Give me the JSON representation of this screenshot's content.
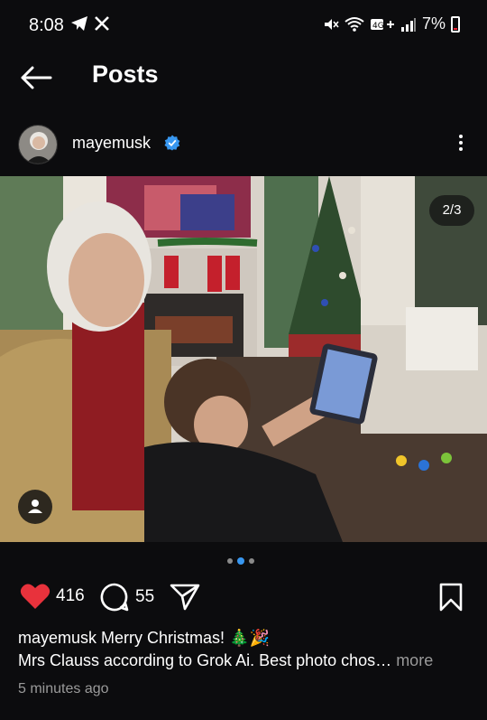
{
  "status_bar": {
    "time": "8:08",
    "left_icons": [
      "telegram-icon",
      "x-icon"
    ],
    "right_icons": [
      "mute-icon",
      "wifi-icon",
      "4g-plus-icon",
      "signal-icon"
    ],
    "battery": "7%"
  },
  "header": {
    "title": "Posts"
  },
  "post": {
    "username": "mayemusk",
    "verified": true,
    "image_counter": "2/3",
    "carousel": {
      "total": 3,
      "active": 2
    },
    "likes": "416",
    "comments": "55",
    "caption_user": "mayemusk",
    "caption_line1": "Merry Christmas! 🎄🎉",
    "caption_line2": "Mrs Clauss according to Grok Ai. Best photo chos…",
    "more_label": " more",
    "timestamp": "5 minutes ago"
  },
  "colors": {
    "background": "#0c0c0e",
    "like_red": "#e8323c",
    "accent_blue": "#3897f0",
    "verified_blue": "#3897f0"
  }
}
